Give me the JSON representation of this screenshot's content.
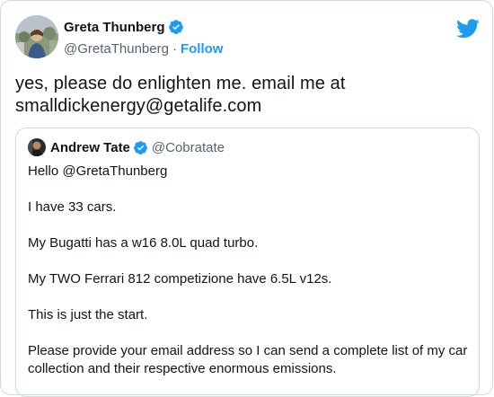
{
  "tweet": {
    "author_name": "Greta Thunberg",
    "author_handle": "@GretaThunberg",
    "separator": "·",
    "follow_label": "Follow",
    "text_line1": "yes, please do enlighten me. email me at",
    "text_line2": "smalldickenergy@getalife.com"
  },
  "quoted": {
    "author_name": "Andrew Tate",
    "author_handle": "@Cobratate",
    "lines": [
      "Hello @GretaThunberg",
      "I have 33 cars.",
      "My Bugatti has a w16 8.0L quad turbo.",
      "My TWO Ferrari 812 competizione have 6.5L v12s.",
      "This is just the start.",
      "Please provide your email address so I can send a complete list of my car",
      "collection and their respective enormous emissions."
    ]
  },
  "icons": {
    "verified": "verified-badge-icon",
    "brand": "twitter-bird-icon"
  },
  "colors": {
    "accent": "#1d9bf0",
    "text": "#0f1419",
    "muted": "#536471",
    "border": "#cfd9de"
  }
}
